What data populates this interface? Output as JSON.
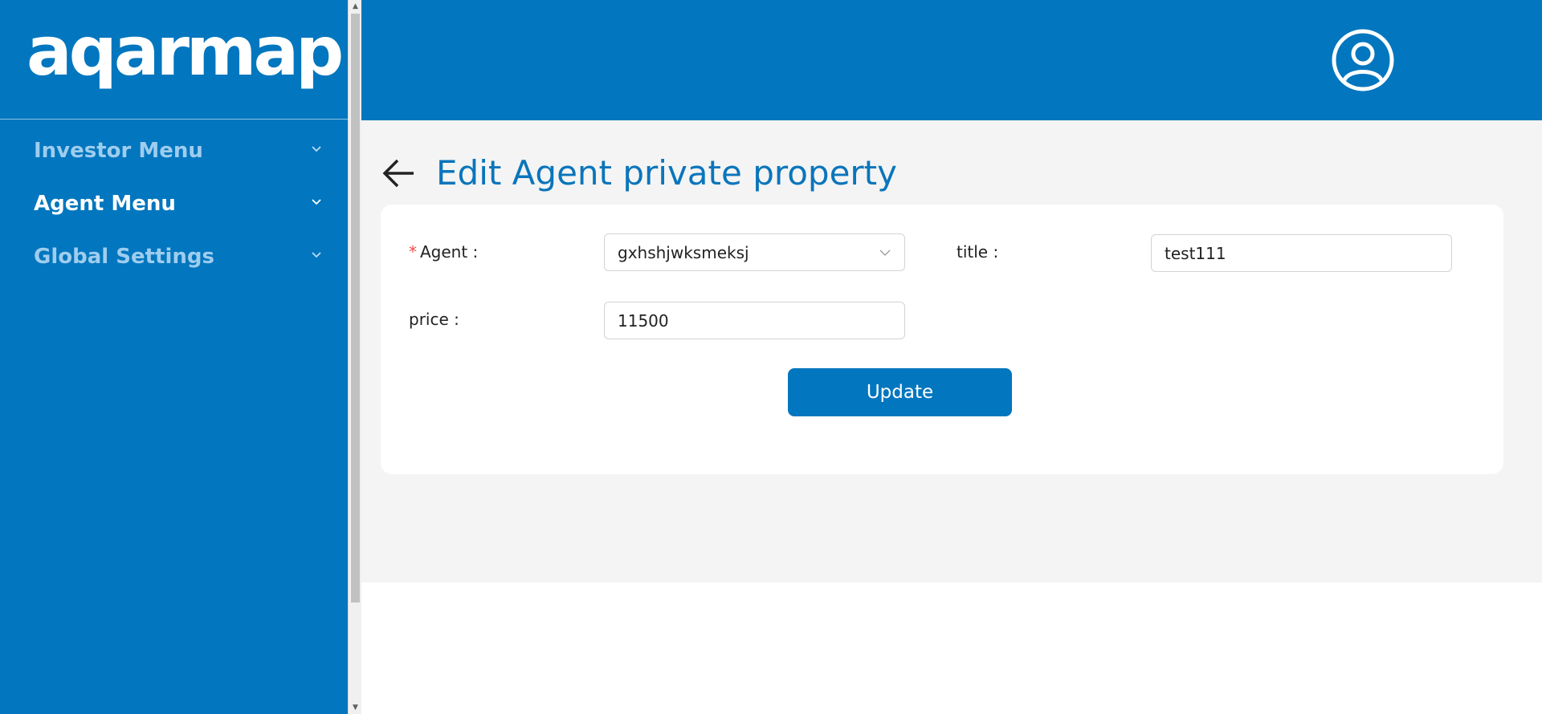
{
  "logo": {
    "text": "aqarmap"
  },
  "sidebar": {
    "items": [
      {
        "label": "Investor Menu",
        "active": false,
        "icon": "chevron-down-icon"
      },
      {
        "label": "Agent Menu",
        "active": true,
        "icon": "chevron-down-icon"
      },
      {
        "label": "Global Settings",
        "active": false,
        "icon": "chevron-down-icon"
      }
    ]
  },
  "header": {
    "avatar_icon": "user-circle-icon"
  },
  "page": {
    "title": "Edit Agent private property",
    "back_icon": "arrow-left-icon"
  },
  "form": {
    "agent": {
      "label": "Agent",
      "required": true,
      "value": "gxhshjwksmeksj"
    },
    "title": {
      "label": "title",
      "value": "test111"
    },
    "price": {
      "label": "price",
      "value": "11500"
    },
    "submit_label": "Update"
  },
  "colors": {
    "brand": "#0276be",
    "title": "#0a75bb",
    "required": "#f24b4b",
    "menu_inactive": "#9fcdee"
  }
}
